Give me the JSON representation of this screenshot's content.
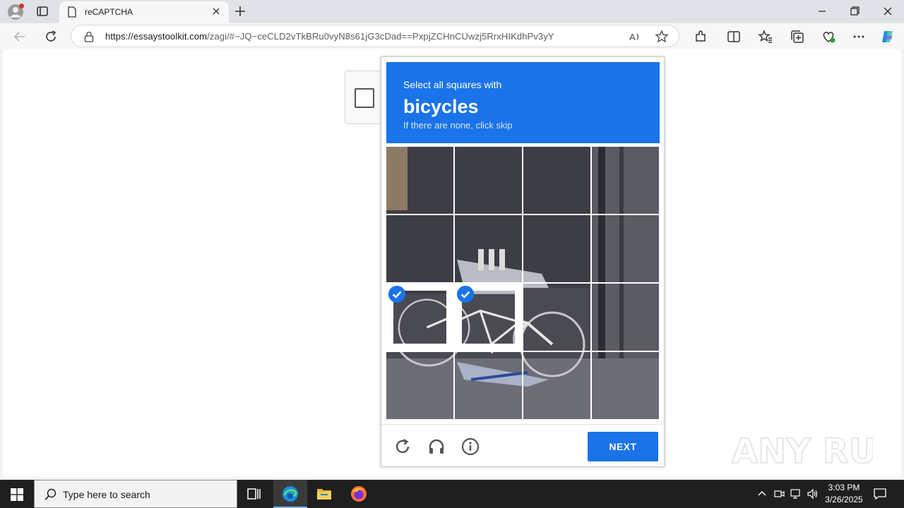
{
  "browser": {
    "tab_title": "reCAPTCHA",
    "url_host": "https://essaystoolkit.com",
    "url_path": "/zagi/#~JQ~ceCLD2vTkBRu0vyN8s61jG3cDad==PxpjZCHnCUwzj5RrxHIKdhPv3yY"
  },
  "captcha": {
    "instruction": "Select all squares with",
    "object": "bicycles",
    "hint": "If there are none, click skip",
    "next_label": "NEXT",
    "tiles": [
      {
        "row": 0,
        "col": 0,
        "selected": false
      },
      {
        "row": 0,
        "col": 1,
        "selected": false
      },
      {
        "row": 0,
        "col": 2,
        "selected": false
      },
      {
        "row": 0,
        "col": 3,
        "selected": false
      },
      {
        "row": 1,
        "col": 0,
        "selected": false
      },
      {
        "row": 1,
        "col": 1,
        "selected": false
      },
      {
        "row": 1,
        "col": 2,
        "selected": false
      },
      {
        "row": 1,
        "col": 3,
        "selected": false
      },
      {
        "row": 2,
        "col": 0,
        "selected": true
      },
      {
        "row": 2,
        "col": 1,
        "selected": true
      },
      {
        "row": 2,
        "col": 2,
        "selected": false
      },
      {
        "row": 2,
        "col": 3,
        "selected": false
      },
      {
        "row": 3,
        "col": 0,
        "selected": false
      },
      {
        "row": 3,
        "col": 1,
        "selected": false
      },
      {
        "row": 3,
        "col": 2,
        "selected": false
      },
      {
        "row": 3,
        "col": 3,
        "selected": false
      }
    ],
    "accent_color": "#1a73e8"
  },
  "watermark": "ANY RUN",
  "taskbar": {
    "search_placeholder": "Type here to search",
    "time": "3:03 PM",
    "date": "3/26/2025"
  }
}
